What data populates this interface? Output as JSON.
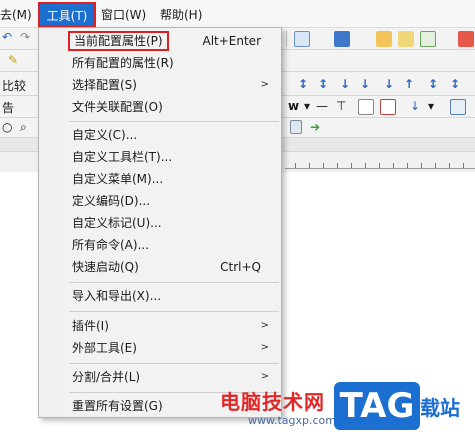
{
  "menubar": {
    "items": [
      {
        "label": "去(M)"
      },
      {
        "label": "工具(T)"
      },
      {
        "label": "窗口(W)"
      },
      {
        "label": "帮助(H)"
      }
    ]
  },
  "background": {
    "compare_label": "比较",
    "left_char": "告"
  },
  "tools_menu": {
    "items": [
      {
        "label": "当前配置属性(P)",
        "shortcut": "Alt+Enter"
      },
      {
        "label": "所有配置的属性(R)"
      },
      {
        "label": "选择配置(S)",
        "submenu": true
      },
      {
        "label": "文件关联配置(O)"
      },
      {
        "label": "自定义(C)..."
      },
      {
        "label": "自定义工具栏(T)..."
      },
      {
        "label": "自定义菜单(M)..."
      },
      {
        "label": "定义编码(D)..."
      },
      {
        "label": "自定义标记(U)..."
      },
      {
        "label": "所有命令(A)..."
      },
      {
        "label": "快速启动(Q)",
        "shortcut": "Ctrl+Q"
      },
      {
        "label": "导入和导出(X)..."
      },
      {
        "label": "插件(I)",
        "submenu": true
      },
      {
        "label": "外部工具(E)",
        "submenu": true
      },
      {
        "label": "分割/合并(L)",
        "submenu": true
      },
      {
        "label": "重置所有设置(G)"
      }
    ]
  },
  "watermark": {
    "title": "电脑技术网",
    "url": "www.tagxp.com",
    "logo": "TAG",
    "side": "载站"
  },
  "colors": {
    "menu_highlight": "#1c6fce",
    "annotation_red": "#e02020",
    "watermark_red": "#e02828",
    "watermark_blue": "#1b6fd1"
  }
}
